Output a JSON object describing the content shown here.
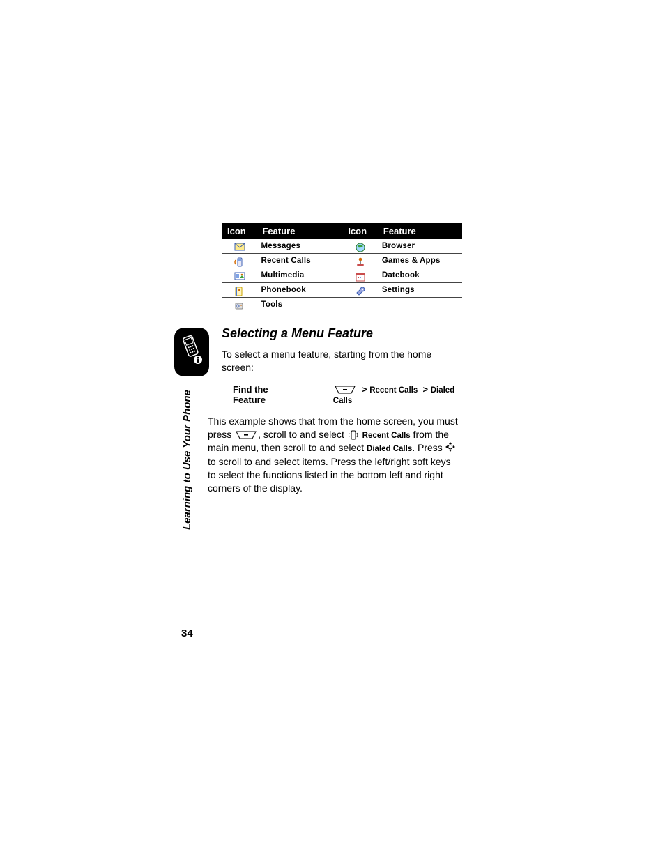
{
  "table": {
    "headers": [
      "Icon",
      "Feature",
      "Icon",
      "Feature"
    ],
    "rows": [
      {
        "l_icon": "envelope",
        "l_feat": "Messages",
        "r_icon": "globe",
        "r_feat": "Browser"
      },
      {
        "l_icon": "phonelog",
        "l_feat": "Recent Calls",
        "r_icon": "joystick",
        "r_feat": "Games & Apps"
      },
      {
        "l_icon": "media",
        "l_feat": "Multimedia",
        "r_icon": "calendar",
        "r_feat": "Datebook"
      },
      {
        "l_icon": "book",
        "l_feat": "Phonebook",
        "r_icon": "wrench",
        "r_feat": "Settings"
      },
      {
        "l_icon": "tools",
        "l_feat": "Tools",
        "r_icon": "",
        "r_feat": ""
      }
    ]
  },
  "heading": "Selecting a Menu Feature",
  "intro": "To select a menu feature, starting from the home screen:",
  "find_label": "Find the Feature",
  "path": {
    "a": "Recent Calls",
    "b": "Dialed Calls"
  },
  "body": {
    "t1": "This example shows that from the home screen, you must press ",
    "t2": ", scroll to and select ",
    "recent": "Recent Calls",
    "t3": " from the main menu, then scroll to and select ",
    "dialed": "Dialed Calls",
    "t4": ". Press ",
    "t5": " to scroll to and select items. Press the left/right soft keys to select the functions listed in the bottom left and right corners of the display."
  },
  "side_label": "Learning to Use Your Phone",
  "page_number": "34"
}
